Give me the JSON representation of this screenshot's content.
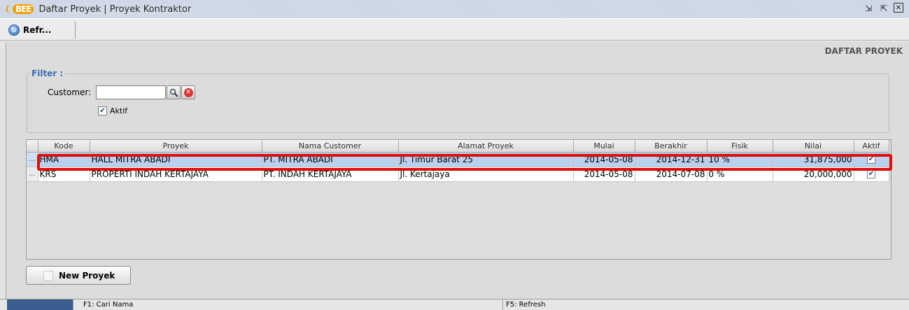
{
  "window": {
    "logo_text": "BEE",
    "title": "Daftar Proyek | Proyek Kontraktor",
    "controls": [
      "restore-icon",
      "maximize-icon",
      "close-icon"
    ]
  },
  "toolbar": {
    "refresh_label": "Refr..."
  },
  "page": {
    "heading": "DAFTAR PROYEK"
  },
  "filter": {
    "legend": "Filter :",
    "customer_label": "Customer:",
    "customer_value": "",
    "aktif_label": "Aktif",
    "aktif_checked": true
  },
  "table": {
    "columns": [
      "Kode",
      "Proyek",
      "Nama Customer",
      "Alamat Proyek",
      "Mulai",
      "Berakhir",
      "Fisik",
      "Nilai",
      "Aktif"
    ],
    "rows": [
      {
        "rownum": "...",
        "kode": "HMA",
        "proyek": "HALL MITRA ABADI",
        "customer": "PT. MITRA ABADI",
        "alamat": "Jl. Timur Barat 25",
        "mulai": "2014-05-08",
        "berakhir": "2014-12-31",
        "fisik": "10 %",
        "nilai": "31,875,000",
        "aktif": true,
        "selected": true
      },
      {
        "rownum": "...",
        "kode": "KRS",
        "proyek": "PROPERTI INDAH KERTAJAYA",
        "customer": "PT. INDAH KERTAJAYA",
        "alamat": "Jl. Kertajaya",
        "mulai": "2014-05-08",
        "berakhir": "2014-07-08",
        "fisik": "0 %",
        "nilai": "20,000,000",
        "aktif": true,
        "selected": false
      }
    ]
  },
  "actions": {
    "new_label": "New Proyek"
  },
  "statusbar": {
    "hint1": "F1: Cari Nama",
    "hint2": "F5: Refresh"
  },
  "colors": {
    "selection": "#b9d1ee",
    "highlight": "#e10e0e",
    "legend": "#3a6fb5",
    "status_block": "#3a5e90"
  }
}
